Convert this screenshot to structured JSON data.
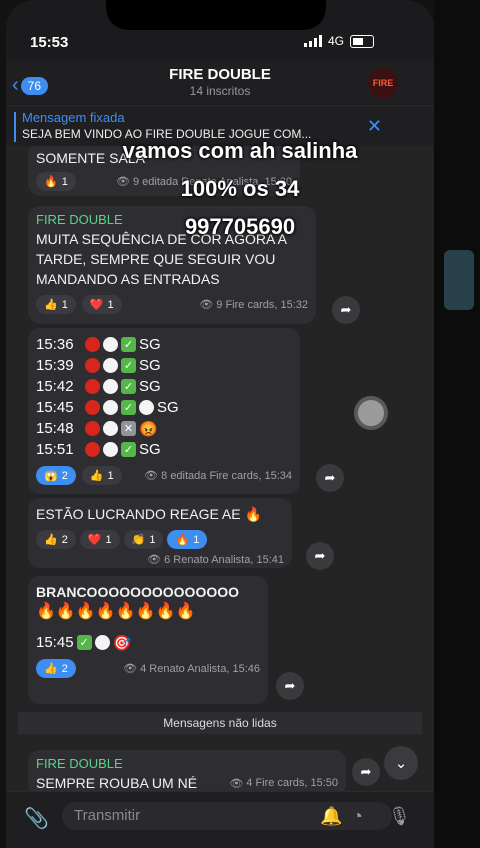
{
  "status": {
    "time": "15:53",
    "network": "4G"
  },
  "header": {
    "back_count": "76",
    "title": "FIRE DOUBLE",
    "subtitle": "14 inscritos",
    "avatar_text": "FIRE"
  },
  "pinned": {
    "label": "Mensagem fixada",
    "text": "SEJA BEM VINDO AO FIRE DOUBLE JOGUE COM..."
  },
  "overlay": {
    "line1": "vamos com ah salinha",
    "line2": "100% os 34",
    "line3": "997705690"
  },
  "msg0": {
    "partial": "SOMENTE SALA",
    "react": "1",
    "meta": "9 editada Renato Analista, 15:30"
  },
  "msg1": {
    "sender": "FIRE DOUBLE",
    "text": "MUITA SEQUÊNCIA DE COR AGORA A TARDE, SEMPRE QUE SEGUIR VOU MANDANDO AS ENTRADAS",
    "r1": "1",
    "r2": "1",
    "meta": "9 Fire cards, 15:32"
  },
  "msg2": {
    "rows": [
      {
        "time": "15:36",
        "result": "SG"
      },
      {
        "time": "15:39",
        "result": "SG"
      },
      {
        "time": "15:42",
        "result": "SG"
      },
      {
        "time": "15:45",
        "result": "SG"
      },
      {
        "time": "15:48",
        "result": "😡"
      },
      {
        "time": "15:51",
        "result": "SG"
      }
    ],
    "r1": "2",
    "r2": "1",
    "meta": "8 editada Fire cards, 15:34"
  },
  "msg3": {
    "text": "ESTÃO LUCRANDO REAGE AE 🔥",
    "r1": "2",
    "r2": "1",
    "r3": "1",
    "r4": "1",
    "meta": "6 Renato Analista, 15:41"
  },
  "msg4": {
    "line1": "BRANCOOOOOOOOOOOOOO",
    "fires": "🔥🔥🔥🔥🔥🔥🔥🔥",
    "time": "15:45",
    "r1": "2",
    "meta": "4 Renato Analista, 15:46"
  },
  "unread": "Mensagens não lidas",
  "msg5": {
    "sender": "FIRE DOUBLE",
    "text": "SEMPRE ROUBA UM NÉ",
    "meta": "4 Fire cards, 15:50"
  },
  "input": {
    "placeholder": "Transmitir"
  }
}
